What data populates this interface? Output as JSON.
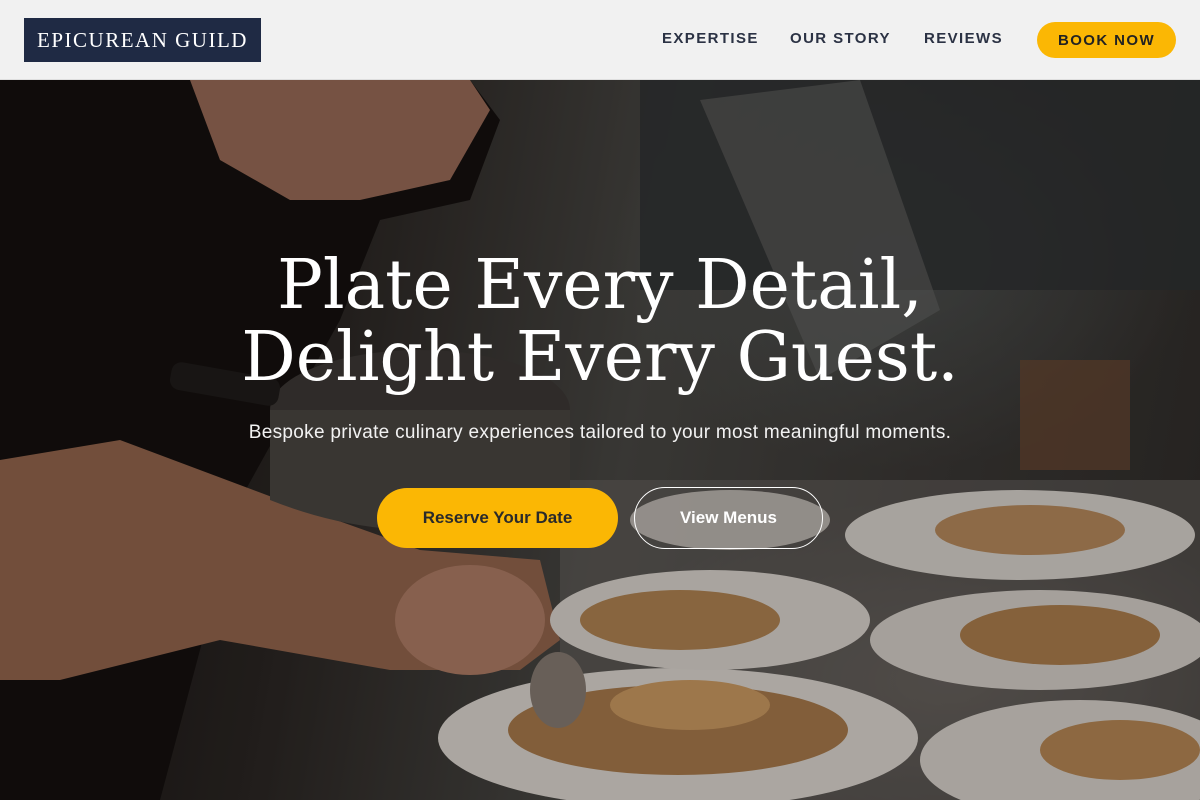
{
  "header": {
    "logo_text": "EPICUREAN GUILD",
    "nav": [
      {
        "label": "EXPERTISE"
      },
      {
        "label": "OUR STORY"
      },
      {
        "label": "REVIEWS"
      }
    ],
    "cta_label": "BOOK NOW"
  },
  "hero": {
    "title_line1": "Plate Every Detail,",
    "title_line2": "Delight Every Guest.",
    "subtitle": "Bespoke private culinary experiences tailored to your most meaningful moments.",
    "primary_button": "Reserve Your Date",
    "secondary_button": "View Menus",
    "background_image": "chef-plating-fish-dishes-photo"
  },
  "colors": {
    "brand_navy": "#1f2a44",
    "accent_gold": "#fbb704",
    "header_bg": "#f1f1f1",
    "nav_text": "#2b3244"
  }
}
